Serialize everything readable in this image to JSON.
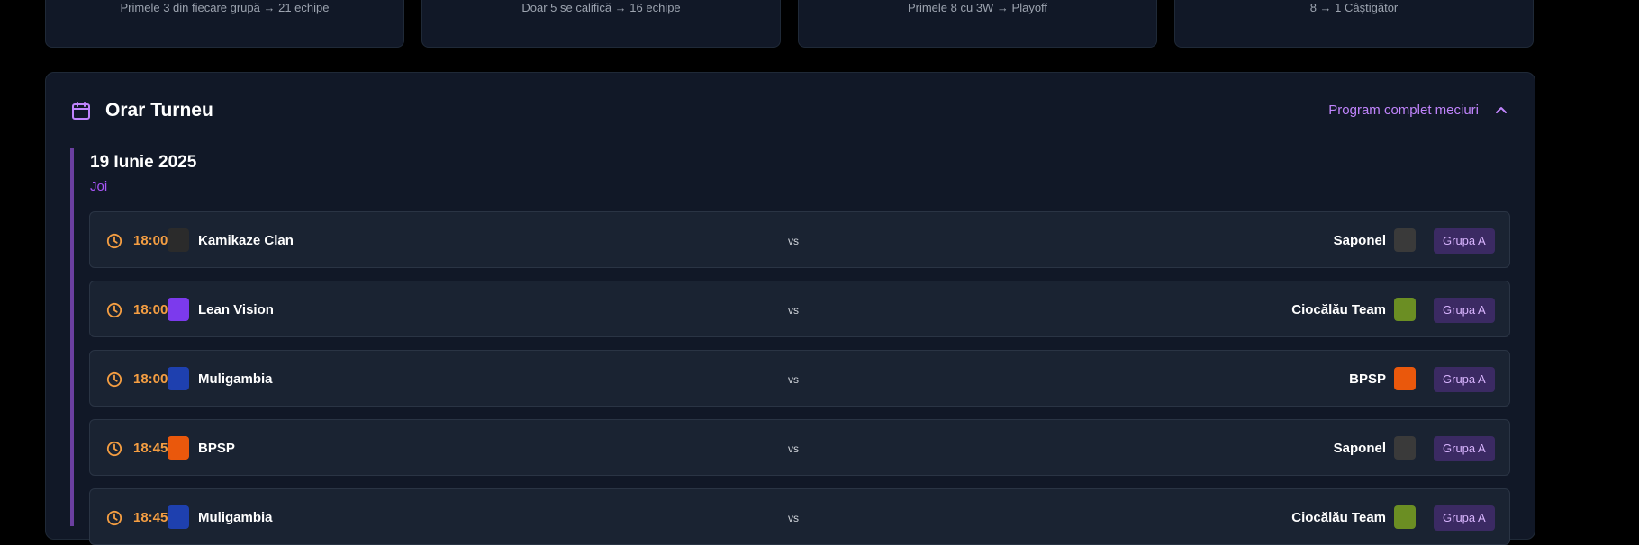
{
  "qualifiers": [
    {
      "text": "Primele 3 din fiecare grupă → 21 echipe"
    },
    {
      "text": "Doar 5 se califică → 16 echipe"
    },
    {
      "text": "Primele 8 cu 3W → Playoff"
    },
    {
      "text": "8 → 1 Câștigător"
    }
  ],
  "schedule": {
    "title": "Orar Turneu",
    "program_link": "Program complet meciuri",
    "date": "19 Iunie 2025",
    "day": "Joi",
    "vs_label": "vs",
    "matches": [
      {
        "time": "18:00",
        "home": "Kamikaze Clan",
        "away": "Saponel",
        "group": "Grupa A",
        "home_logo_color": "#2b2b2b",
        "away_logo_color": "#3a3a3a"
      },
      {
        "time": "18:00",
        "home": "Lean Vision",
        "away": "Ciocălău Team",
        "group": "Grupa A",
        "home_logo_color": "#7c3aed",
        "away_logo_color": "#6b8e23"
      },
      {
        "time": "18:00",
        "home": "Muligambia",
        "away": "BPSP",
        "group": "Grupa A",
        "home_logo_color": "#1e40af",
        "away_logo_color": "#ea580c"
      },
      {
        "time": "18:45",
        "home": "BPSP",
        "away": "Saponel",
        "group": "Grupa A",
        "home_logo_color": "#ea580c",
        "away_logo_color": "#3a3a3a"
      },
      {
        "time": "18:45",
        "home": "Muligambia",
        "away": "Ciocălău Team",
        "group": "Grupa A",
        "home_logo_color": "#1e40af",
        "away_logo_color": "#6b8e23"
      }
    ]
  },
  "colors": {
    "accent": "#c084fc",
    "time": "#f59e42",
    "panel": "#111827",
    "row": "#1a2332",
    "badge": "#3b2a63"
  }
}
